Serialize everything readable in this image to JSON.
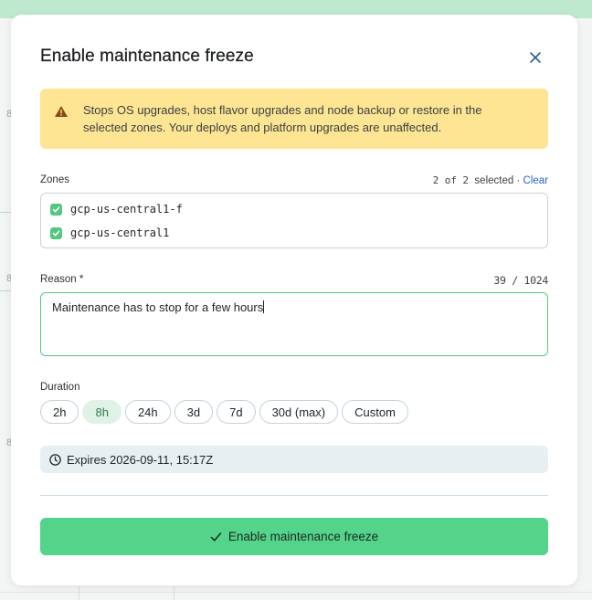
{
  "background": {
    "side_numbers": [
      "8",
      "8",
      "8"
    ]
  },
  "modal": {
    "title": "Enable maintenance freeze",
    "close_icon": "close-icon",
    "alert": {
      "icon": "warning-icon",
      "text": "Stops OS upgrades, host flavor upgrades and node backup or restore in the selected zones. Your deploys and platform upgrades are unaffected."
    },
    "zones": {
      "label": "Zones",
      "selected_count": "2",
      "of_label": "of",
      "total_count": "2",
      "selected_label": "selected",
      "separator": "·",
      "clear_label": "Clear",
      "items": [
        {
          "name": "gcp-us-central1-f",
          "checked": true
        },
        {
          "name": "gcp-us-central1",
          "checked": true
        }
      ]
    },
    "reason": {
      "label": "Reason *",
      "value": "Maintenance has to stop for a few hours",
      "char_count": "39",
      "char_sep": "/",
      "char_max": "1024"
    },
    "duration": {
      "label": "Duration",
      "options": [
        "2h",
        "8h",
        "24h",
        "3d",
        "7d",
        "30d (max)",
        "Custom"
      ],
      "selected": "8h"
    },
    "expires": {
      "icon": "clock-icon",
      "text": "Expires 2026-09-11, 15:17Z"
    },
    "submit": {
      "icon": "check-icon",
      "label": "Enable maintenance freeze"
    },
    "colors": {
      "accent": "#54d38a",
      "alert_bg": "#fde593",
      "link": "#2462c5"
    }
  }
}
